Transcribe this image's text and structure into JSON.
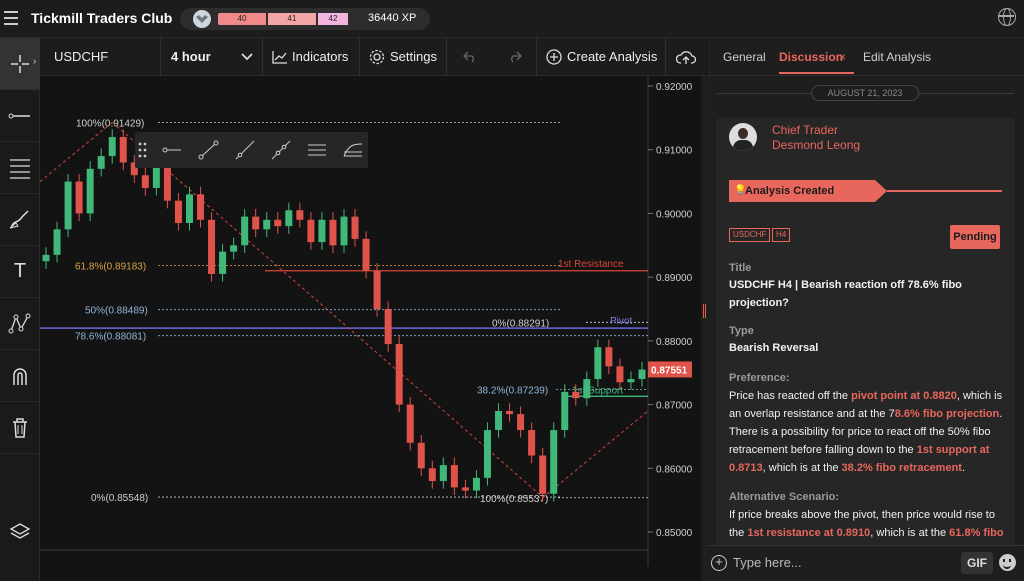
{
  "app": {
    "title": "Tickmill Traders Club",
    "menu_icon": "hamburger-menu-icon",
    "globe_icon": "globe-icon"
  },
  "level": {
    "levels": [
      "40",
      "41",
      "42"
    ],
    "progress_current": 0.5,
    "xp": "36440 XP",
    "badge_icon": "rank-badge-icon"
  },
  "toolbar": {
    "symbol": "USDCHF",
    "timeframe": "4 hour",
    "indicators": "Indicators",
    "settings": "Settings",
    "create_analysis": "Create Analysis"
  },
  "left_tools": [
    "crosshair-icon",
    "horizontal-line-icon",
    "fibonacci-icon",
    "brush-icon",
    "text-icon",
    "pattern-icon",
    "magnet-icon",
    "trash-icon",
    "layers-icon"
  ],
  "drawing_toolbar_icons": [
    "drag-handle-icon",
    "horizontal-ray-icon",
    "segment-icon",
    "line-icon",
    "extended-line-icon",
    "parallel-channel-icon",
    "fib-channel-icon"
  ],
  "chart_data": {
    "type": "line",
    "title": "",
    "symbol": "USDCHF",
    "timeframe": "4 hour",
    "ylim": [
      0.85,
      0.92
    ],
    "y_ticks": [
      "0.92000",
      "0.91000",
      "0.90000",
      "0.89000",
      "0.88000",
      "0.87000",
      "0.86000",
      "0.85000"
    ],
    "current_price": "0.87551",
    "series": [
      {
        "values": [
          0.8935,
          0.8975,
          0.905,
          0.9,
          0.907,
          0.909,
          0.912,
          0.908,
          0.906,
          0.904,
          0.909,
          0.902,
          0.8985,
          0.903,
          0.899,
          0.8905,
          0.894,
          0.895,
          0.8995,
          0.8975,
          0.899,
          0.898,
          0.9005,
          0.899,
          0.8955,
          0.899,
          0.895,
          0.8995,
          0.896,
          0.891,
          0.885,
          0.8795,
          0.87,
          0.864,
          0.86,
          0.858,
          0.8605,
          0.857,
          0.8565,
          0.8585,
          0.866,
          0.869,
          0.8685,
          0.866,
          0.862,
          0.856,
          0.866,
          0.872,
          0.871,
          0.874,
          0.879,
          0.876,
          0.8735,
          0.874,
          0.8755
        ]
      }
    ],
    "annotations": [
      {
        "text": "100%(0.91429)",
        "y": 0.91429
      },
      {
        "text": "61.8%(0.89183)",
        "y": 0.89183
      },
      {
        "text": "50%(0.88489)",
        "y": 0.88489
      },
      {
        "text": "78.6%(0.88081)",
        "y": 0.88081
      },
      {
        "text": "0%(0.85548)",
        "y": 0.85548
      },
      {
        "text": "0%(0.88291)",
        "y": 0.88291
      },
      {
        "text": "38.2%(0.87239)",
        "y": 0.87239
      },
      {
        "text": "100%(0.85537)",
        "y": 0.85537
      },
      {
        "text": "1st Resistance",
        "y": 0.891
      },
      {
        "text": "Pivot",
        "y": 0.882
      },
      {
        "text": "1st Support",
        "y": 0.8713
      }
    ]
  },
  "panel": {
    "tabs": [
      "General",
      "Discussion",
      "Edit Analysis"
    ],
    "tab_close": "×",
    "date": "AUGUST 21, 2023",
    "author_role": "Chief Trader",
    "author_name": "Desmond Leong",
    "event": "Analysis Created",
    "tags": [
      "USDCHF",
      "H4"
    ],
    "status": "Pending",
    "title_label": "Title",
    "title_value": "USDCHF H4 | Bearish reaction off 78.6% fibo projection?",
    "type_label": "Type",
    "type_value": "Bearish Reversal",
    "preference_label": "Preference:",
    "preference_text": [
      {
        "t": "Price has reacted off the ",
        "h": false
      },
      {
        "t": "pivot point at 0.8820",
        "h": true
      },
      {
        "t": ", which is an overlap resistance and at the 7",
        "h": false
      },
      {
        "t": "8.6% fibo projection",
        "h": true
      },
      {
        "t": ". There is a possibility for price to react off the 50% fibo retracement before falling down to the ",
        "h": false
      },
      {
        "t": "1st support at 0.8713",
        "h": true
      },
      {
        "t": ", which is at the ",
        "h": false
      },
      {
        "t": "38.2% fibo retracement",
        "h": true
      },
      {
        "t": ".",
        "h": false
      }
    ],
    "alt_label": "Alternative Scenario:",
    "alt_text": [
      {
        "t": "If price breaks above the pivot, then price would rise to the ",
        "h": false
      },
      {
        "t": "1st resistance at 0.8910",
        "h": true
      },
      {
        "t": ", which is at the ",
        "h": false
      },
      {
        "t": "61.8% fibo",
        "h": true
      }
    ],
    "composer_placeholder": "Type here...",
    "gif": "GIF"
  }
}
